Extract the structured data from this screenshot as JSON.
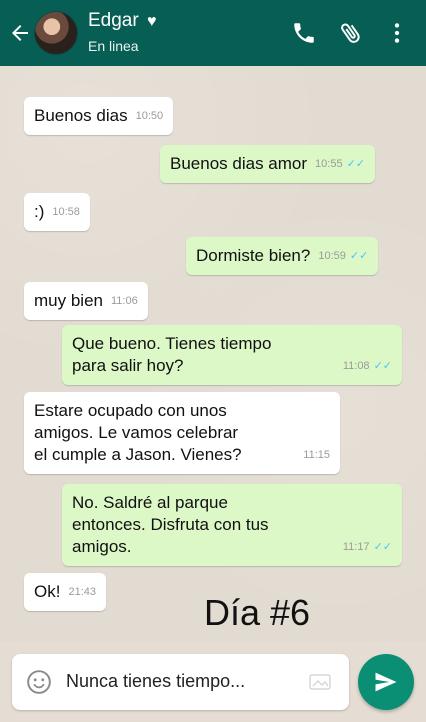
{
  "header": {
    "contact_name": "Edgar",
    "heart": "♥",
    "status": "En linea",
    "back_icon": "arrow-left-icon",
    "call_icon": "phone-icon",
    "attach_icon": "paperclip-icon",
    "more_icon": "more-vert-icon",
    "colors": {
      "bar": "#075e54",
      "text": "#ffffff"
    }
  },
  "messages": [
    {
      "dir": "in",
      "text": "Buenos dias",
      "time": "10:50"
    },
    {
      "dir": "out",
      "text": "Buenos dias amor",
      "time": "10:55"
    },
    {
      "dir": "in",
      "text": ":)",
      "time": "10:58"
    },
    {
      "dir": "out",
      "text": "Dormiste bien?",
      "time": "10:59"
    },
    {
      "dir": "in",
      "text": "muy bien",
      "time": "11:06"
    },
    {
      "dir": "out",
      "text": "Que bueno. Tienes tiempo\npara salir hoy?",
      "time": "11:08"
    },
    {
      "dir": "in",
      "text": "Estare ocupado con unos\namigos. Le vamos celebrar\nel cumple a Jason. Vienes?",
      "time": "11:15"
    },
    {
      "dir": "out",
      "text": "No. Saldré al parque\nentonces. Disfruta con tus\namigos.",
      "time": "11:17"
    },
    {
      "dir": "in",
      "text": "Ok!",
      "time": "21:43"
    }
  ],
  "overlay": {
    "day_label": "Día #6"
  },
  "composer": {
    "value": "Nunca tienes tiempo...",
    "emoji_icon": "emoji-icon",
    "attach_icon": "attachment-icon",
    "send_icon": "send-icon"
  },
  "colors": {
    "outgoing_bubble": "#dcf8c6",
    "incoming_bubble": "#ffffff",
    "read_ticks": "#4fc3f7",
    "send_button": "#0a8f74"
  }
}
